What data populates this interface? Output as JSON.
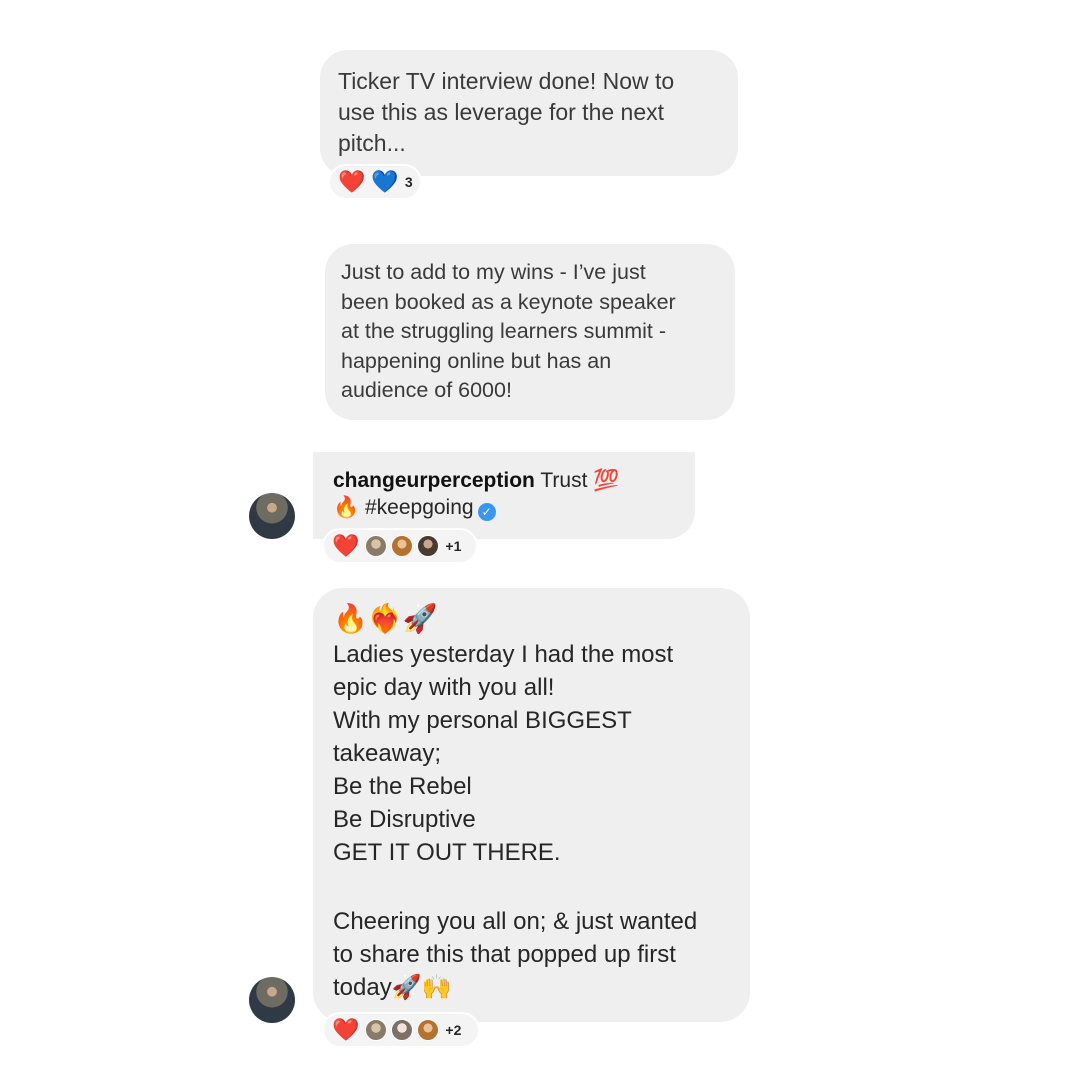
{
  "messages": [
    {
      "text": "Ticker TV interview done! Now to use this as leverage for the next pitch...",
      "lines": [
        "Ticker TV interview done! Now to",
        "use this as leverage for the next",
        "pitch..."
      ],
      "reactions": {
        "emojis": [
          "❤️",
          "💙"
        ],
        "count": "3"
      }
    },
    {
      "lines": [
        "Just to add to my wins - I’ve just",
        "been booked as a keynote speaker",
        "at the struggling learners summit -",
        "happening online but has an",
        "audience of 6000!"
      ]
    },
    {
      "username": "changeurperception",
      "text": "Trust 💯",
      "line2": "🔥 #keepgoing",
      "verified_icon": "verified-badge-icon",
      "reactions": {
        "emoji": "❤️",
        "count": "+1"
      }
    },
    {
      "emoji_line": "🔥❤️‍🔥🚀",
      "lines": [
        "Ladies yesterday I had the most",
        "epic day with you all!",
        "With my personal BIGGEST",
        "takeaway;",
        "Be the Rebel",
        "Be Disruptive",
        "GET IT OUT THERE.",
        "",
        "Cheering you all on; & just wanted",
        "to share this that popped up first",
        "today🚀🙌"
      ],
      "reactions": {
        "emoji": "❤️",
        "count": "+2"
      }
    }
  ],
  "colors": {
    "bubble": "#efefef",
    "heart_red": "#e0243a",
    "heart_blue": "#1f7ae8",
    "verified": "#3897f0"
  }
}
